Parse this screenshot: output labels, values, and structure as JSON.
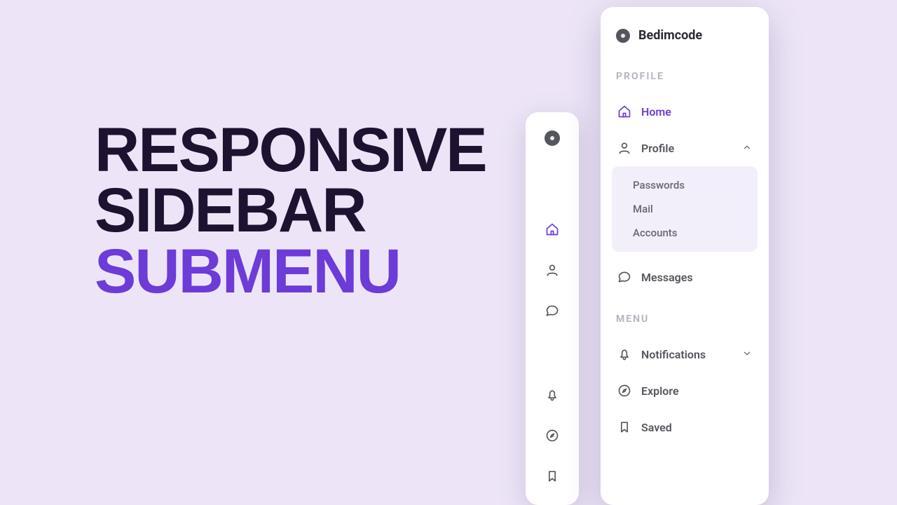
{
  "headline": {
    "line1": "RESPONSIVE",
    "line2": "SIDEBAR",
    "line3": "SUBMENU"
  },
  "brand": {
    "name": "Bedimcode"
  },
  "sections": {
    "profile_title": "PROFILE",
    "menu_title": "MENU"
  },
  "items": {
    "home": "Home",
    "profile": "Profile",
    "messages": "Messages",
    "notifications": "Notifications",
    "explore": "Explore",
    "saved": "Saved"
  },
  "submenu": {
    "passwords": "Passwords",
    "mail": "Mail",
    "accounts": "Accounts"
  },
  "colors": {
    "accent": "#6d3bd8",
    "dark": "#1d1330",
    "bg": "#ede5f7"
  }
}
